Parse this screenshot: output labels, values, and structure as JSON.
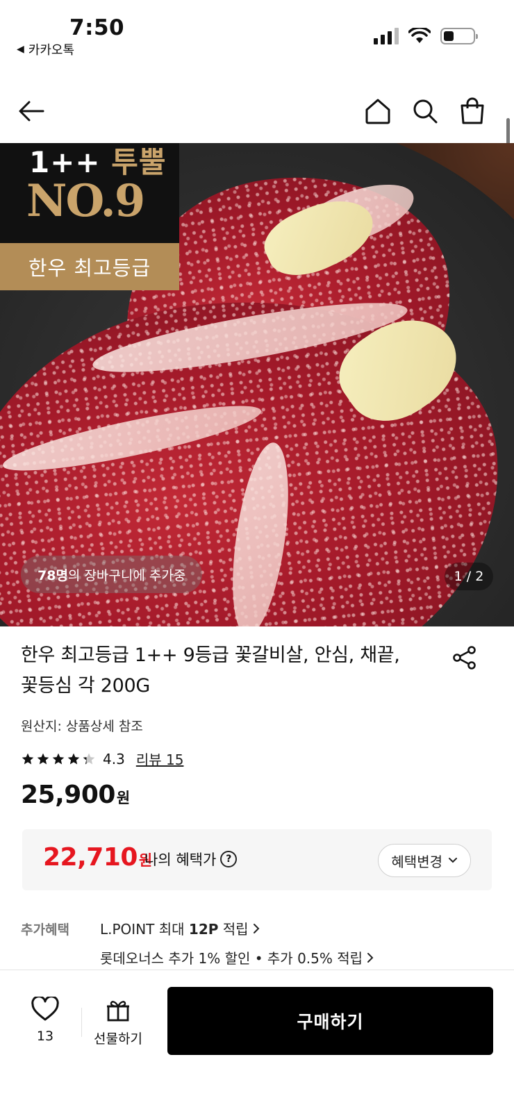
{
  "status_bar": {
    "time": "7:50",
    "back_app": "카카오톡"
  },
  "header": {
    "back_icon": "arrow-left-icon",
    "home_icon": "home-icon",
    "search_icon": "search-icon",
    "cart_icon": "shopping-bag-icon"
  },
  "hero": {
    "badge_line1_a": "1++ ",
    "badge_line1_b": "투뿔",
    "badge_no": "NO.9",
    "badge_gold": "한우 최고등급",
    "cart_count": "78명",
    "cart_suffix": "의 장바구니에 추가중",
    "page_indicator": "1 / 2"
  },
  "product": {
    "title_line1": "한우 최고등급 1++ 9등급 꽃갈비살, 안심, 채끝,",
    "title_line2": "꽃등심 각 200G",
    "origin": "원산지: 상품상세 참조",
    "rating": "4.3",
    "rating_value": 4.3,
    "review_link": "리뷰 15",
    "price": "25,900",
    "price_unit": "원"
  },
  "benefit": {
    "price": "22,710",
    "price_unit": "원",
    "label": "나의 혜택가",
    "help_glyph": "?",
    "change_button": "혜택변경"
  },
  "extra": {
    "label": "추가혜택",
    "line1_a": "L.POINT 최대 ",
    "line1_b": "12P",
    "line1_c": " 적립",
    "line2": "롯데오너스 추가 1% 할인 • 추가 0.5% 적립"
  },
  "bottom_bar": {
    "wish_count": "13",
    "gift_label": "선물하기",
    "buy_label": "구매하기"
  },
  "colors": {
    "accent_red": "#e6161f",
    "gold": "#caa46b",
    "gold_band": "#b38d57",
    "buy_button": "#000000"
  }
}
